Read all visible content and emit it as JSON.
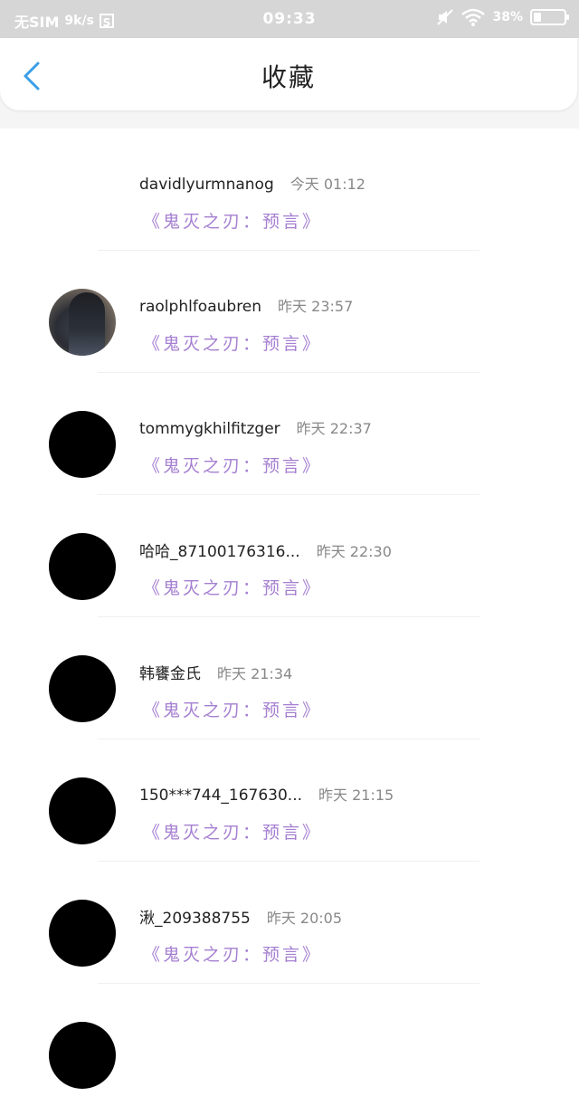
{
  "status_bar": {
    "sim": "无SIM",
    "speed": "9k/s",
    "sim_icon_label": "S",
    "time": "09:33",
    "battery": "38%"
  },
  "header": {
    "title": "收藏"
  },
  "favorites": [
    {
      "user": "davidlyurmnanog",
      "time": "今天 01:12",
      "work": "《鬼灭之刃：预言》",
      "avatar": "none"
    },
    {
      "user": "raolphlfoaubren",
      "time": "昨天 23:57",
      "work": "《鬼灭之刃：预言》",
      "avatar": "photo"
    },
    {
      "user": "tommygkhilfitzger",
      "time": "昨天 22:37",
      "work": "《鬼灭之刃：预言》",
      "avatar": "black"
    },
    {
      "user": "哈哈_87100176316...",
      "time": "昨天 22:30",
      "work": "《鬼灭之刃：预言》",
      "avatar": "black"
    },
    {
      "user": "韩饔金氏",
      "time": "昨天 21:34",
      "work": "《鬼灭之刃：预言》",
      "avatar": "black"
    },
    {
      "user": "150***744_167630...",
      "time": "昨天 21:15",
      "work": "《鬼灭之刃：预言》",
      "avatar": "black"
    },
    {
      "user": "湫_209388755",
      "time": "昨天 20:05",
      "work": "《鬼灭之刃：预言》",
      "avatar": "black"
    },
    {
      "user": "",
      "time": "",
      "work": "",
      "avatar": "black"
    }
  ],
  "colors": {
    "accent_blue": "#3a9ee8",
    "work_purple": "#a57fd1",
    "status_bar_bg": "#d6d6d6"
  }
}
